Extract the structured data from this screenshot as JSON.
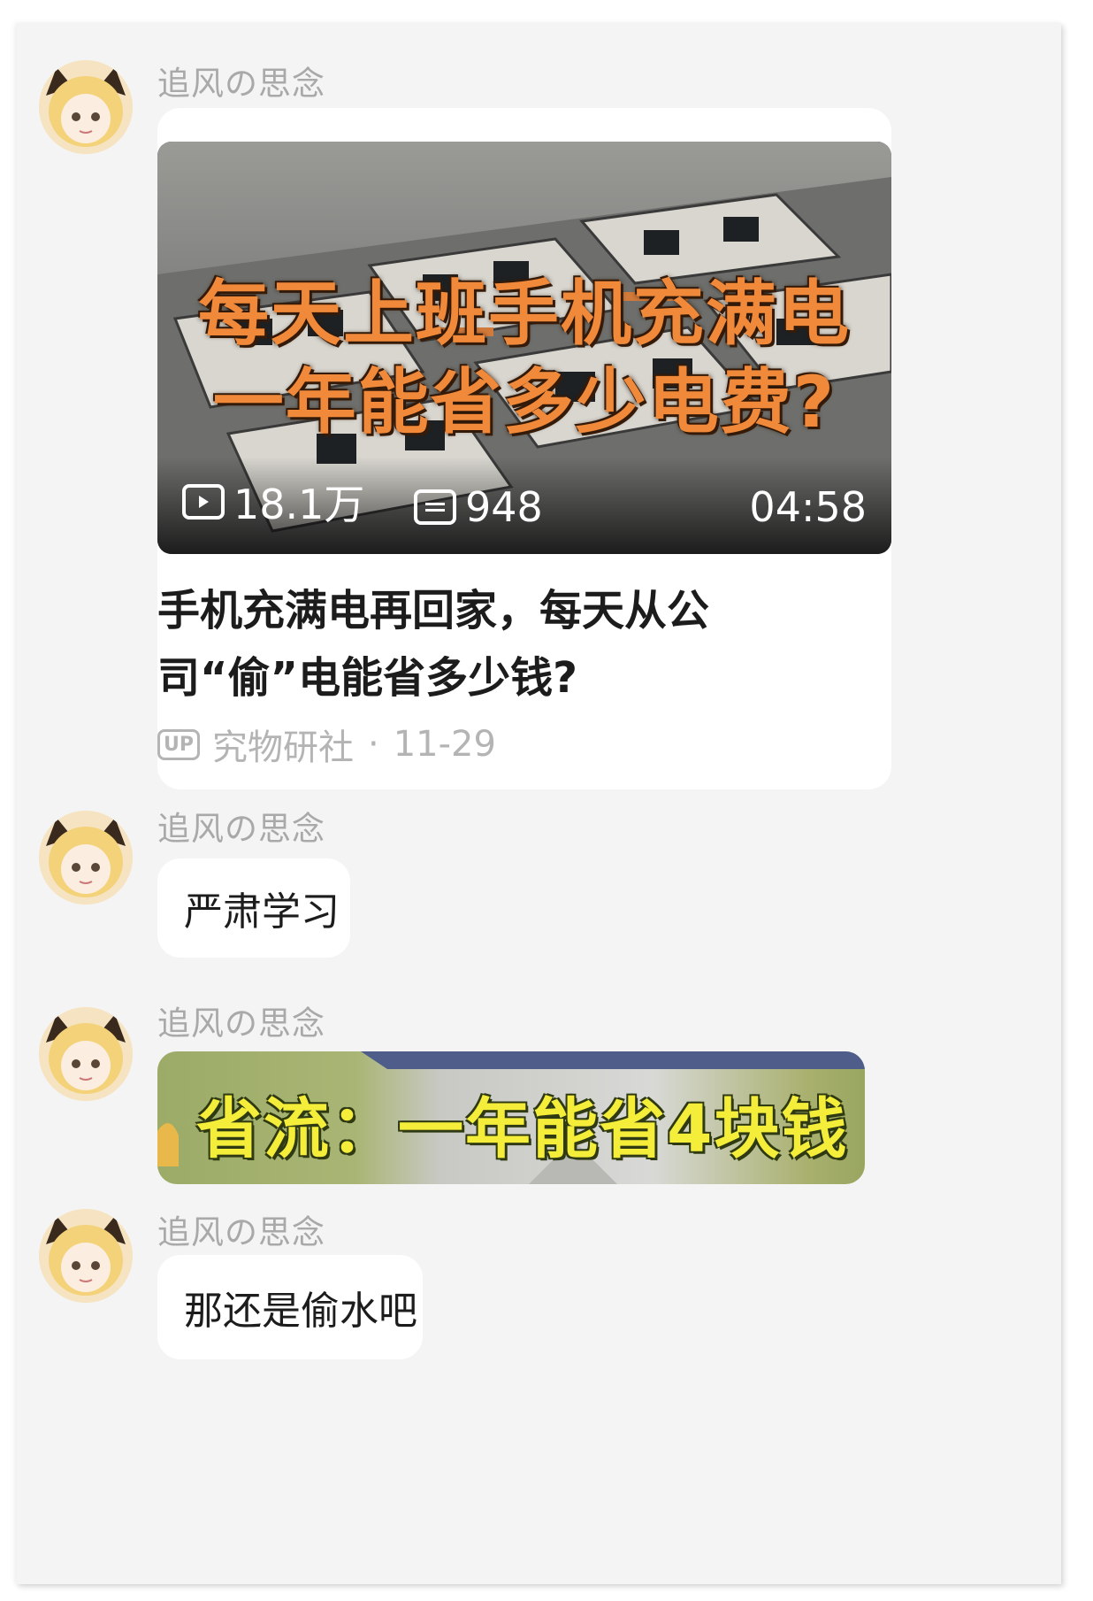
{
  "messages": [
    {
      "sender": "追风の思念",
      "video": {
        "thumb_title_line1": "每天上班手机充满电",
        "thumb_title_line2": "一年能省多少电费?",
        "views": "18.1万",
        "comments": "948",
        "duration": "04:58",
        "title": "手机充满电再回家，每天从公司“偷”电能省多少钱?",
        "up_badge": "UP",
        "uploader": "究物研社",
        "separator": "·",
        "date": "11-29"
      }
    },
    {
      "sender": "追风の思念",
      "text": "严肃学习"
    },
    {
      "sender": "追风の思念",
      "sticker_text": "省流：一年能省4块钱"
    },
    {
      "sender": "追风の思念",
      "text": "那还是偷水吧"
    }
  ],
  "colors": {
    "background": "#f4f4f4",
    "bubble": "#ffffff",
    "sender_name": "#a9a9a9",
    "thumb_title": "#f08a3a",
    "sticker_text": "#f4ee3a"
  }
}
